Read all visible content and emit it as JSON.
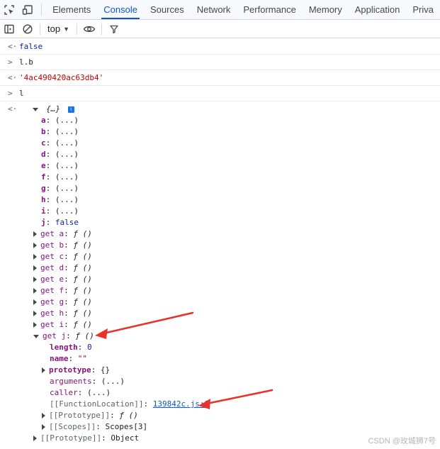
{
  "tabs": [
    {
      "label": "Elements"
    },
    {
      "label": "Console"
    },
    {
      "label": "Sources"
    },
    {
      "label": "Network"
    },
    {
      "label": "Performance"
    },
    {
      "label": "Memory"
    },
    {
      "label": "Application"
    },
    {
      "label": "Priva"
    }
  ],
  "toolbar": {
    "context": "top",
    "icons": [
      "sidebar-toggle-icon",
      "clear-console-icon",
      "eye-icon",
      "filter-icon"
    ]
  },
  "console": {
    "lines": [
      {
        "kind": "result",
        "text": "false"
      },
      {
        "kind": "input",
        "text": "l.b"
      },
      {
        "kind": "result",
        "text": "'4ac490420ac63db4'"
      },
      {
        "kind": "input",
        "text": "l"
      }
    ],
    "object": {
      "summary": "{…}",
      "props": [
        {
          "name": "a",
          "value": "(...)"
        },
        {
          "name": "b",
          "value": "(...)"
        },
        {
          "name": "c",
          "value": "(...)"
        },
        {
          "name": "d",
          "value": "(...)"
        },
        {
          "name": "e",
          "value": "(...)"
        },
        {
          "name": "f",
          "value": "(...)"
        },
        {
          "name": "g",
          "value": "(...)"
        },
        {
          "name": "h",
          "value": "(...)"
        },
        {
          "name": "i",
          "value": "(...)"
        },
        {
          "name": "j",
          "value": "false"
        }
      ],
      "getters": [
        {
          "label": "get a",
          "value": "ƒ ()"
        },
        {
          "label": "get b",
          "value": "ƒ ()"
        },
        {
          "label": "get c",
          "value": "ƒ ()"
        },
        {
          "label": "get d",
          "value": "ƒ ()"
        },
        {
          "label": "get e",
          "value": "ƒ ()"
        },
        {
          "label": "get f",
          "value": "ƒ ()"
        },
        {
          "label": "get g",
          "value": "ƒ ()"
        },
        {
          "label": "get h",
          "value": "ƒ ()"
        },
        {
          "label": "get i",
          "value": "ƒ ()"
        }
      ],
      "getter_j": {
        "label": "get j",
        "value": "ƒ ()",
        "children": {
          "length_key": "length",
          "length_val": "0",
          "name_key": "name",
          "name_val": "\"\"",
          "prototype_key": "prototype",
          "prototype_val": "{}",
          "arguments_key": "arguments",
          "arguments_val": "(...)",
          "caller_key": "caller",
          "caller_val": "(...)",
          "fnloc_key": "[[FunctionLocation]]",
          "fnloc_link": "139842c.js:1",
          "proto_key": "[[Prototype]]",
          "proto_val": "ƒ ()",
          "scopes_key": "[[Scopes]]",
          "scopes_val": "Scopes[3]"
        }
      },
      "prototype_key": "[[Prototype]]",
      "prototype_val": "Object"
    }
  },
  "watermark": "CSDN @玫城狮7号",
  "colors": {
    "accent": "#0b57d0",
    "arrow": "#e8322b",
    "string": "#c80000"
  }
}
